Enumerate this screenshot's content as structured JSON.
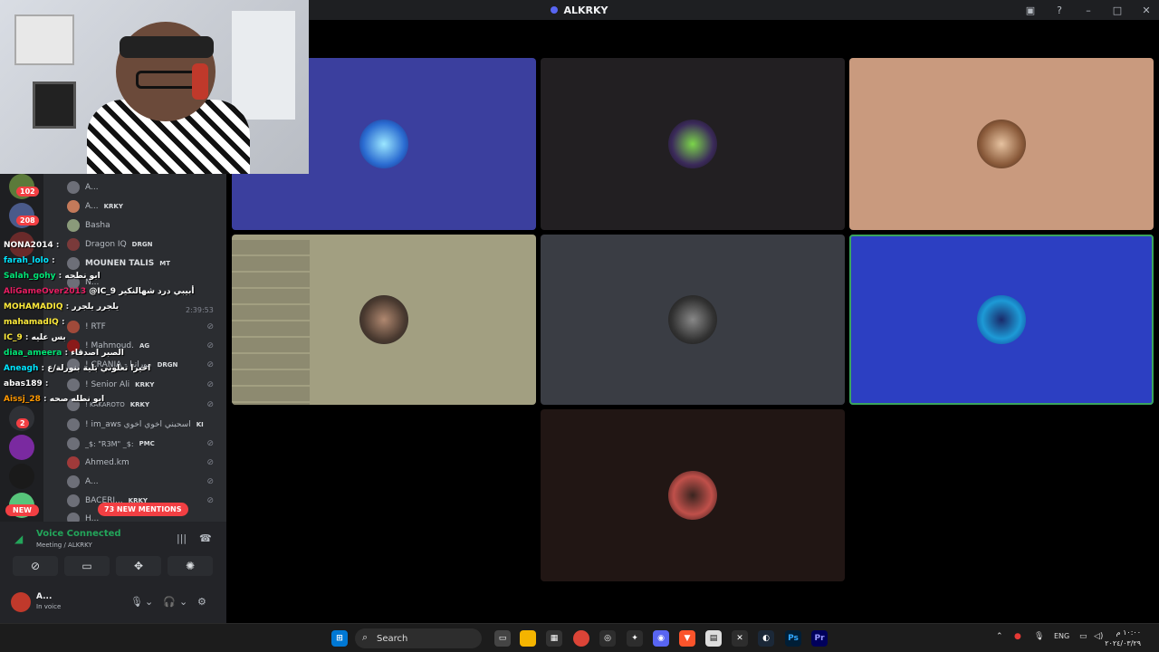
{
  "window": {
    "title": "ALKRKY"
  },
  "sidebar": {
    "server_badges": [
      "102",
      "208",
      "2"
    ],
    "new_label": "NEW",
    "members": [
      {
        "name": "A...",
        "tag": ""
      },
      {
        "name": "A...",
        "tag": "KRKY"
      },
      {
        "name": "Basha",
        "tag": ""
      },
      {
        "name": "Dragon IQ",
        "tag": "DRGN"
      },
      {
        "name": "MOUNEN TALIS",
        "tag": "MT"
      },
      {
        "name": "N...",
        "tag": ""
      },
      {
        "name": "! RTF",
        "tag": ""
      },
      {
        "name": "! Mahmoud.",
        "tag": "AG"
      },
      {
        "name": "! CRANIA - موراتيا",
        "tag": "DRGN"
      },
      {
        "name": "! Senior Ali",
        "tag": "KRKY"
      },
      {
        "name": "! KAKAROTO",
        "tag": "KRKY"
      },
      {
        "name": "! im_aws اسحبني اخوي اخوي",
        "tag": "KI"
      },
      {
        "name": "_$: \"R3M\" _$:",
        "tag": "PMC"
      },
      {
        "name": "Ahmed.km",
        "tag": ""
      },
      {
        "name": "A...",
        "tag": ""
      },
      {
        "name": "BACERI...",
        "tag": "KRKY"
      },
      {
        "name": "H...",
        "tag": ""
      }
    ],
    "timestamp": "2:39:53",
    "mentions_label": "73 NEW MENTIONS"
  },
  "chat_overlay": [
    {
      "user": "NONA2014",
      "msg": "",
      "color": "#ffffff"
    },
    {
      "user": "farah_lolo",
      "msg": "",
      "color": "#00e5ff"
    },
    {
      "user": "Salah_gohy",
      "msg": "ابو نطحه",
      "color": "#00e676"
    },
    {
      "user": "AliGameOver2013",
      "msg": "@IC_9 أبيبي درد شهالنكير",
      "color": "#e91e63"
    },
    {
      "user": "MOHAMADIQ",
      "msg": "يلجرر يلجرر",
      "color": "#ffeb3b"
    },
    {
      "user": "mahamadIQ",
      "msg": "",
      "color": "#ffeb3b"
    },
    {
      "user": "IC_9",
      "msg": "بس عليه",
      "color": "#ffeb3b"
    },
    {
      "user": "diaa_ameera",
      "msg": "الصبر اصدقاء",
      "color": "#00e676"
    },
    {
      "user": "Aneagh",
      "msg": "اخيرا تعلوني بلية بنورلة/ع",
      "color": "#00e5ff"
    },
    {
      "user": "abas189",
      "msg": "",
      "color": "#ffffff"
    },
    {
      "user": "Aissj_28",
      "msg": "ابو نطله صحه",
      "color": "#ff9800"
    }
  ],
  "voice": {
    "status": "Voice Connected",
    "room": "Meeting / ALKRKY",
    "user_name": "A...",
    "user_status": "In voice"
  },
  "tiles": [
    {
      "bg": "#3b3f9e"
    },
    {
      "bg": "#221f22"
    },
    {
      "bg": "#c99a7e"
    },
    {
      "bg": "#a29f81"
    },
    {
      "bg": "#3a3d44"
    },
    {
      "bg": "#2c3fc2",
      "active": true
    },
    {
      "bg": "#211614"
    }
  ],
  "taskbar": {
    "search_label": "Search",
    "lang": "ENG",
    "time": "١٠:٠٠ م",
    "date": "٢٠٢٤/٠٣/٢٩"
  },
  "colors": {
    "accent": "#5865f2",
    "voice_green": "#23a55a",
    "danger": "#f23f43"
  }
}
